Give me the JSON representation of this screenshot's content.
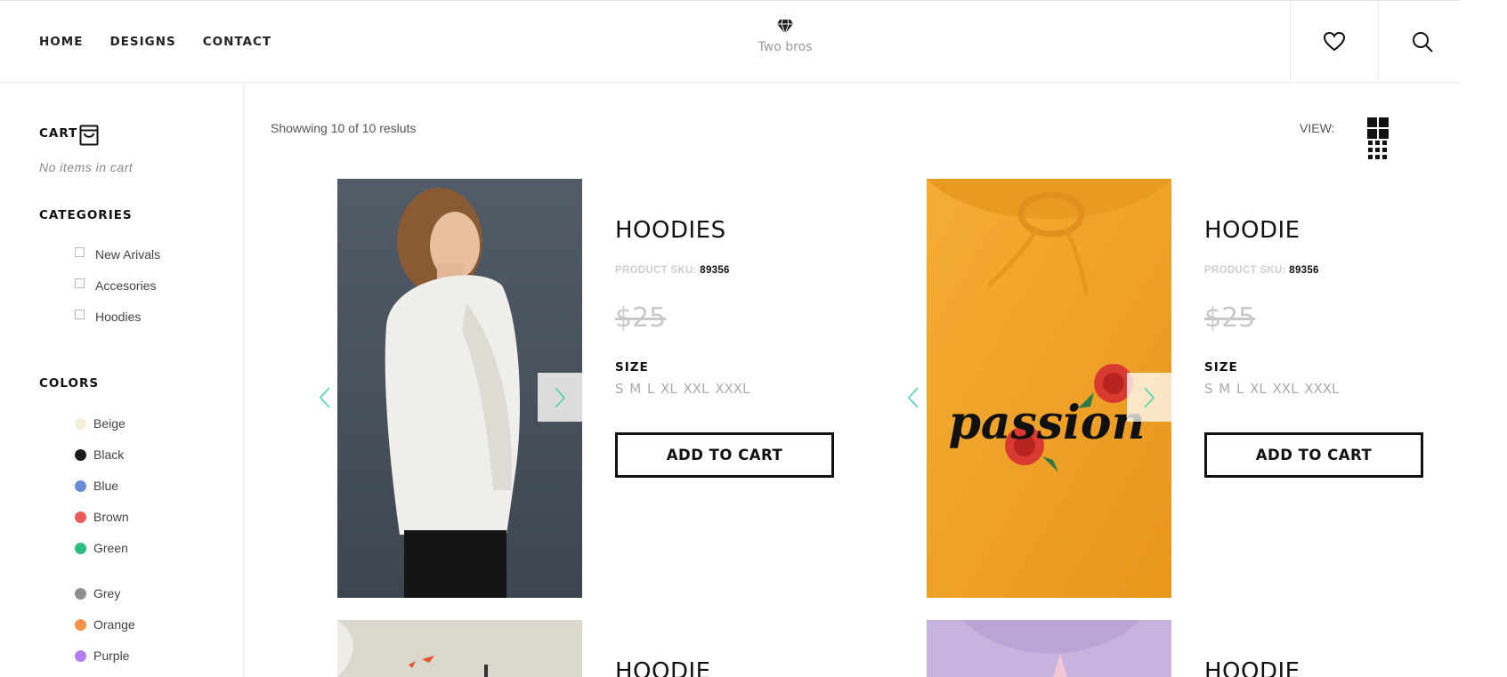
{
  "header": {
    "nav": [
      "HOME",
      "DESIGNS",
      "CONTACT"
    ],
    "brand_name": "Two bros",
    "icons": [
      "diamond-icon",
      "heart-icon",
      "search-icon"
    ]
  },
  "sidebar": {
    "cart_title": "CART",
    "cart_empty": "No items in cart",
    "categories_title": "CATEGORIES",
    "categories": [
      "New Arivals",
      "Accesories",
      "Hoodies"
    ],
    "colors_title": "COLORS",
    "colors": [
      {
        "label": "Beige",
        "color": "#f3efd8"
      },
      {
        "label": "Black",
        "color": "#1c1c1c"
      },
      {
        "label": "Blue",
        "color": "#6b8bd6"
      },
      {
        "label": "Brown",
        "color": "#ec5a5a"
      },
      {
        "label": "Green",
        "color": "#2dbd7e"
      },
      {
        "label": "Grey",
        "color": "#8f8f8f"
      },
      {
        "label": "Orange",
        "color": "#f5934a"
      },
      {
        "label": "Purple",
        "color": "#b57ef0"
      }
    ]
  },
  "toolbar": {
    "showing": "Showwing 10 of 10 resluts",
    "view_label": "VIEW:"
  },
  "products": [
    {
      "title": "HOODIES",
      "sku_label": "PRODUCT SKU:",
      "sku": "89356",
      "price": "$25",
      "size_label": "SIZE",
      "sizes": "S M L XL XXL XXXL",
      "button": "ADD TO CART"
    },
    {
      "title": "HOODIE",
      "sku_label": "PRODUCT SKU:",
      "sku": "89356",
      "price": "$25",
      "size_label": "SIZE",
      "sizes": "S M L XL XXL XXXL",
      "button": "ADD TO CART"
    },
    {
      "title": "HOODIE"
    },
    {
      "title": "HOODIE"
    }
  ],
  "graphic_text": "passion",
  "accent_color": "#3ed6b0"
}
